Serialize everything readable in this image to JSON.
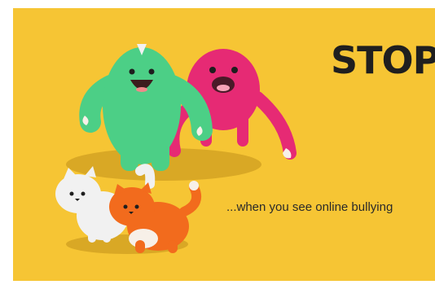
{
  "poster": {
    "title": "STOP",
    "caption": "...when you see online bullying"
  },
  "colors": {
    "background": "#f6c534",
    "shadow": "#d9a825",
    "green_monster": "#4ccf86",
    "pink_monster": "#e62a74",
    "white_cat": "#f1f1f1",
    "orange_cat": "#f26b1d",
    "title_text": "#1f1f1f"
  },
  "characters": [
    {
      "name": "green-monster",
      "icon": "green-horned-monster"
    },
    {
      "name": "pink-monster",
      "icon": "pink-fluffy-monster"
    },
    {
      "name": "white-cat",
      "icon": "white-fluffy-cat"
    },
    {
      "name": "orange-cat",
      "icon": "orange-tabby-cat"
    }
  ]
}
